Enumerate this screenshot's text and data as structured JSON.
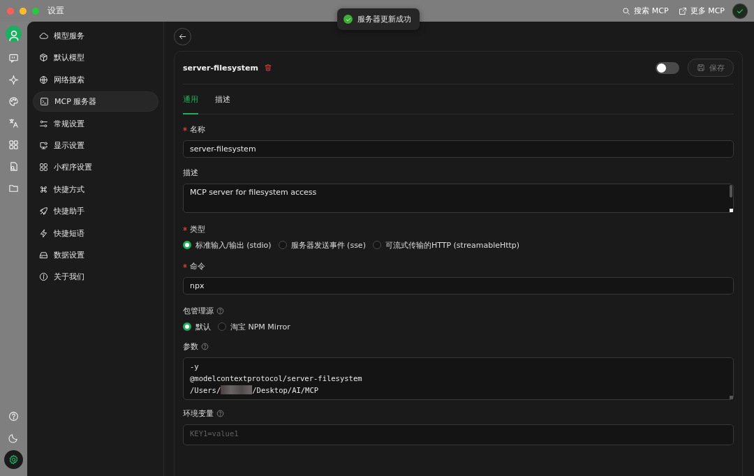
{
  "window": {
    "title": "设置"
  },
  "titlebar_actions": [
    {
      "label": "搜索 MCP"
    },
    {
      "label": "更多 MCP"
    }
  ],
  "toast": {
    "text": "服务器更新成功"
  },
  "rail": {
    "top": [
      {
        "selected": false
      },
      {
        "selected": false
      },
      {
        "selected": false
      },
      {
        "selected": false
      },
      {
        "selected": false
      },
      {
        "selected": false
      },
      {
        "selected": false
      }
    ],
    "bottom": [
      {
        "selected": false
      },
      {
        "selected": false
      },
      {
        "selected": true
      }
    ]
  },
  "sidebar": {
    "items": [
      {
        "label": "模型服务",
        "selected": false
      },
      {
        "label": "默认模型",
        "selected": false
      },
      {
        "label": "网络搜索",
        "selected": false
      },
      {
        "label": "MCP 服务器",
        "selected": true
      },
      {
        "label": "常规设置",
        "selected": false
      },
      {
        "label": "显示设置",
        "selected": false
      },
      {
        "label": "小程序设置",
        "selected": false
      },
      {
        "label": "快捷方式",
        "selected": false
      },
      {
        "label": "快捷助手",
        "selected": false
      },
      {
        "label": "快捷短语",
        "selected": false
      },
      {
        "label": "数据设置",
        "selected": false
      },
      {
        "label": "关于我们",
        "selected": false
      }
    ]
  },
  "server": {
    "name": "server-filesystem",
    "enabled": false,
    "save_label": "保存",
    "save_disabled": true
  },
  "tabs": [
    {
      "label": "通用",
      "selected": true
    },
    {
      "label": "描述",
      "selected": false
    }
  ],
  "fields": [
    {
      "kind": "input",
      "label": "名称",
      "required": true,
      "value": "server-filesystem"
    },
    {
      "kind": "textarea",
      "label": "描述",
      "value": "MCP server for filesystem access"
    },
    {
      "kind": "radio",
      "label": "类型",
      "required": true,
      "options": [
        {
          "label": "标准输入/输出 (stdio)",
          "selected": true
        },
        {
          "label": "服务器发送事件 (sse)",
          "selected": false
        },
        {
          "label": "可流式传输的HTTP (streamableHttp)",
          "selected": false
        }
      ]
    },
    {
      "kind": "input",
      "label": "命令",
      "required": true,
      "value": "npx"
    },
    {
      "kind": "radio",
      "label": "包管理源",
      "help": true,
      "options": [
        {
          "label": "默认",
          "selected": true
        },
        {
          "label": "淘宝 NPM Mirror",
          "selected": false
        }
      ]
    },
    {
      "kind": "code",
      "label": "参数",
      "help": true,
      "lines": [
        [
          {
            "kind": "text",
            "text": "-y"
          }
        ],
        [
          {
            "kind": "text",
            "text": "@modelcontextprotocol/server-filesystem"
          }
        ],
        [
          {
            "kind": "text",
            "text": "/Users/"
          },
          {
            "kind": "redacted"
          },
          {
            "kind": "text",
            "text": "/Desktop/AI/MCP"
          }
        ]
      ]
    },
    {
      "kind": "code",
      "label": "环境变量",
      "help": true,
      "placeholder": "KEY1=value1"
    }
  ]
}
